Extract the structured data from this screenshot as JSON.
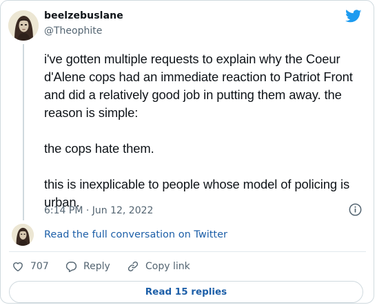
{
  "author": {
    "name": "beelzebuslane",
    "handle": "@Theophite"
  },
  "tweet": {
    "paragraphs": [
      "i've gotten multiple requests to explain why the Coeur d'Alene cops had an immediate reaction to Patriot Front and did a relatively good job in putting them away. the reason is simple:",
      "the cops hate them.",
      "this is inexplicable to people whose model of policing is urban."
    ],
    "timestamp": "6:14 PM · Jun 12, 2022"
  },
  "conversation_link": "Read the full conversation on Twitter",
  "actions": {
    "like_count": "707",
    "reply_label": "Reply",
    "copy_label": "Copy link"
  },
  "read_replies_label": "Read 15 replies",
  "colors": {
    "brand": "#1d9bf0",
    "link": "#1d5fa8",
    "muted": "#536471",
    "border": "#cfd9de"
  },
  "icons": [
    "twitter-bird-icon",
    "info-icon",
    "heart-icon",
    "reply-icon",
    "link-icon"
  ]
}
